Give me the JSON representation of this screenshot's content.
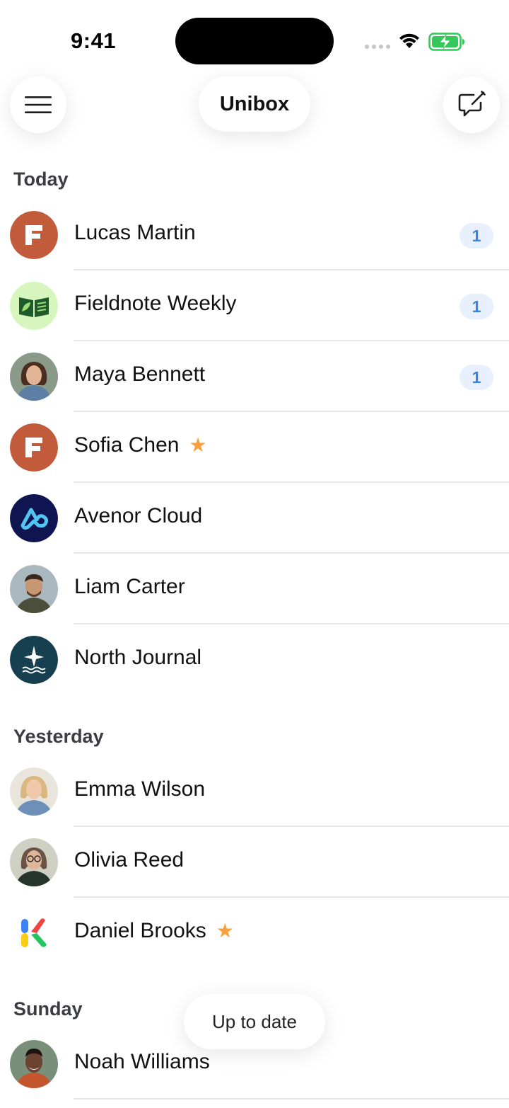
{
  "status_bar": {
    "time": "9:41"
  },
  "header": {
    "title": "Unibox",
    "menu_icon": "hamburger-icon",
    "compose_icon": "compose-icon"
  },
  "sections": [
    {
      "label": "Today",
      "items": [
        {
          "name": "Lucas Martin",
          "badge": "1",
          "starred": false,
          "avatar": "f-logo"
        },
        {
          "name": "Fieldnote Weekly",
          "badge": "1",
          "starred": false,
          "avatar": "book-leaf-logo"
        },
        {
          "name": "Maya Bennett",
          "badge": "1",
          "starred": false,
          "avatar": "photo-woman"
        },
        {
          "name": "Sofia Chen",
          "badge": null,
          "starred": true,
          "avatar": "f-logo"
        },
        {
          "name": "Avenor Cloud",
          "badge": null,
          "starred": false,
          "avatar": "cloud-logo"
        },
        {
          "name": "Liam Carter",
          "badge": null,
          "starred": false,
          "avatar": "photo-man"
        },
        {
          "name": "North Journal",
          "badge": null,
          "starred": false,
          "avatar": "star-wave-logo"
        }
      ]
    },
    {
      "label": "Yesterday",
      "items": [
        {
          "name": "Emma Wilson",
          "badge": null,
          "starred": false,
          "avatar": "photo-woman-blonde"
        },
        {
          "name": "Olivia Reed",
          "badge": null,
          "starred": false,
          "avatar": "photo-woman-glasses"
        },
        {
          "name": "Daniel Brooks",
          "badge": null,
          "starred": true,
          "avatar": "k-logo"
        }
      ]
    },
    {
      "label": "Sunday",
      "items": [
        {
          "name": "Noah Williams",
          "badge": null,
          "starred": false,
          "avatar": "photo-man-dark"
        }
      ]
    }
  ],
  "toast": {
    "text": "Up to date"
  },
  "colors": {
    "badge_bg": "#e7f0fc",
    "badge_text": "#3a82e4",
    "star": "#f7a03d",
    "battery": "#34c759"
  }
}
